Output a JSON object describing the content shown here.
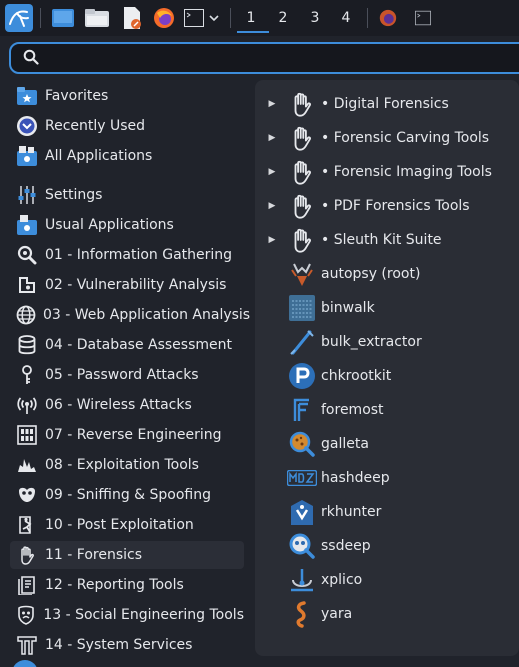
{
  "panel": {
    "launchers": [
      {
        "icon": "kali-menu-icon"
      },
      {
        "icon": "show-desktop-icon"
      },
      {
        "icon": "file-manager-icon"
      },
      {
        "icon": "text-editor-icon"
      },
      {
        "icon": "firefox-icon"
      },
      {
        "icon": "terminal-icon"
      }
    ],
    "workspaces": [
      "1",
      "2",
      "3",
      "4"
    ],
    "active_workspace": "1"
  },
  "search": {
    "value": "",
    "placeholder": ""
  },
  "categories": [
    {
      "label": "Favorites",
      "icon": "favorites-icon"
    },
    {
      "label": "Recently Used",
      "icon": "recently-used-icon"
    },
    {
      "label": "All Applications",
      "icon": "all-applications-icon"
    },
    {
      "label": "Settings",
      "icon": "settings-icon"
    },
    {
      "label": "Usual Applications",
      "icon": "usual-applications-icon"
    },
    {
      "label": "01 - Information Gathering",
      "icon": "magnifier-icon"
    },
    {
      "label": "02 - Vulnerability Analysis",
      "icon": "vulnerability-icon"
    },
    {
      "label": "03 - Web Application Analysis",
      "icon": "globe-icon"
    },
    {
      "label": "04 - Database Assessment",
      "icon": "database-icon"
    },
    {
      "label": "05 - Password Attacks",
      "icon": "key-icon"
    },
    {
      "label": "06 - Wireless Attacks",
      "icon": "wireless-icon"
    },
    {
      "label": "07 - Reverse Engineering",
      "icon": "reverse-engineering-icon"
    },
    {
      "label": "08 - Exploitation Tools",
      "icon": "exploitation-icon"
    },
    {
      "label": "09 - Sniffing & Spoofing",
      "icon": "sniffing-icon"
    },
    {
      "label": "10 - Post Exploitation",
      "icon": "post-exploitation-icon"
    },
    {
      "label": "11 - Forensics",
      "icon": "forensics-hand-icon"
    },
    {
      "label": "12 - Reporting Tools",
      "icon": "reporting-icon"
    },
    {
      "label": "13 - Social Engineering Tools",
      "icon": "social-engineering-icon"
    },
    {
      "label": "14 - System Services",
      "icon": "system-services-icon"
    }
  ],
  "selected_category": "11 - Forensics",
  "submenus": [
    {
      "label": "• Digital Forensics",
      "icon": "forensics-hand-icon"
    },
    {
      "label": "• Forensic Carving Tools",
      "icon": "forensics-hand-icon"
    },
    {
      "label": "• Forensic Imaging Tools",
      "icon": "forensics-hand-icon"
    },
    {
      "label": "• PDF Forensics Tools",
      "icon": "forensics-hand-icon"
    },
    {
      "label": "• Sleuth Kit Suite",
      "icon": "forensics-hand-icon"
    }
  ],
  "apps": [
    {
      "label": "autopsy (root)",
      "icon": "autopsy-icon"
    },
    {
      "label": "binwalk",
      "icon": "binwalk-icon"
    },
    {
      "label": "bulk_extractor",
      "icon": "bulk-extractor-icon"
    },
    {
      "label": "chkrootkit",
      "icon": "chkrootkit-icon"
    },
    {
      "label": "foremost",
      "icon": "foremost-icon"
    },
    {
      "label": "galleta",
      "icon": "galleta-icon"
    },
    {
      "label": "hashdeep",
      "icon": "hashdeep-icon"
    },
    {
      "label": "rkhunter",
      "icon": "rkhunter-icon"
    },
    {
      "label": "ssdeep",
      "icon": "ssdeep-icon"
    },
    {
      "label": "xplico",
      "icon": "xplico-icon"
    },
    {
      "label": "yara",
      "icon": "yara-icon"
    }
  ],
  "colors": {
    "accent": "#3d8ddb",
    "background": "#20232b",
    "pane": "#2a2d35",
    "selection": "#2b2e37"
  }
}
